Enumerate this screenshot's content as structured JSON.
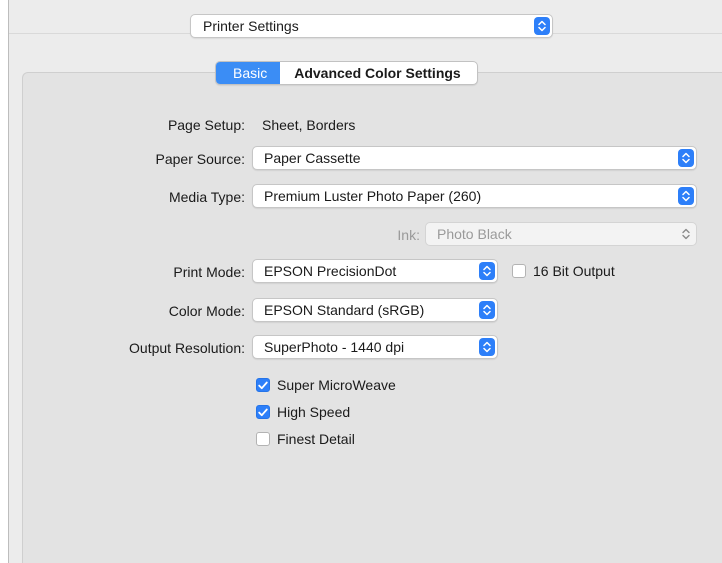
{
  "header": {
    "panel_selector": "Printer Settings"
  },
  "tabs": [
    {
      "label": "Basic",
      "active": true
    },
    {
      "label": "Advanced Color Settings",
      "active": false
    }
  ],
  "form": {
    "page_setup": {
      "label": "Page Setup:",
      "value": "Sheet, Borders"
    },
    "paper_source": {
      "label": "Paper Source:",
      "value": "Paper Cassette"
    },
    "media_type": {
      "label": "Media Type:",
      "value": "Premium Luster Photo Paper (260)"
    },
    "ink": {
      "label": "Ink:",
      "value": "Photo Black",
      "enabled": false
    },
    "print_mode": {
      "label": "Print Mode:",
      "value": "EPSON PrecisionDot"
    },
    "bit_output": {
      "label": "16 Bit Output",
      "checked": false
    },
    "color_mode": {
      "label": "Color Mode:",
      "value": "EPSON Standard (sRGB)"
    },
    "output_resolution": {
      "label": "Output Resolution:",
      "value": "SuperPhoto - 1440 dpi"
    },
    "options": [
      {
        "label": "Super MicroWeave",
        "checked": true
      },
      {
        "label": "High Speed",
        "checked": true
      },
      {
        "label": "Finest Detail",
        "checked": false
      }
    ]
  },
  "colors": {
    "accent": "#2d7ff9",
    "panel_bg": "#ececec",
    "group_bg": "#e3e3e3"
  },
  "icons": {
    "popup_arrows": "updown-chevron-icon",
    "checkmark": "checkmark-icon"
  }
}
